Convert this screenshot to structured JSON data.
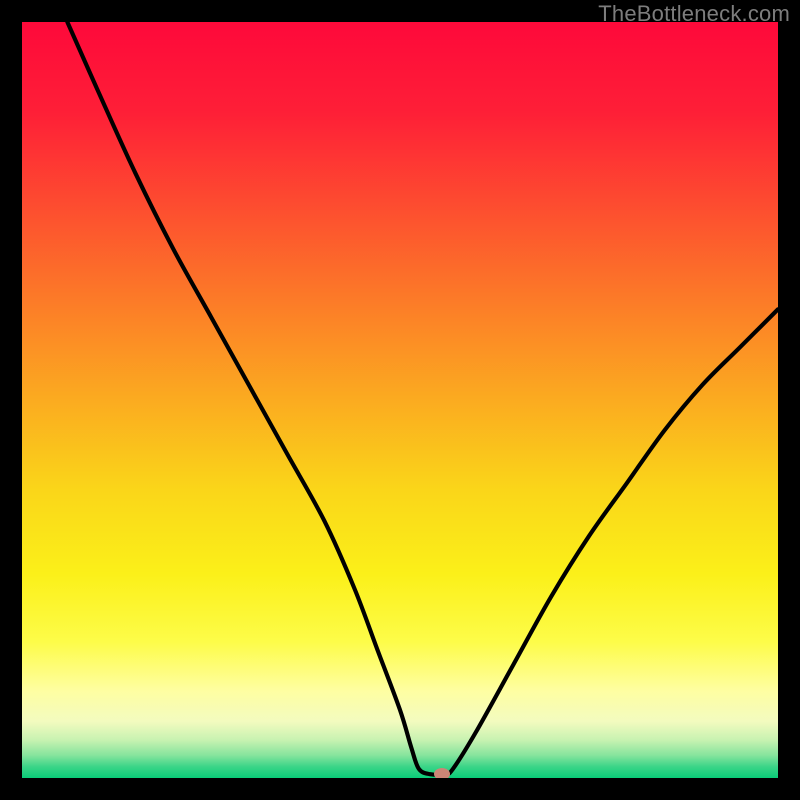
{
  "watermark": "TheBottleneck.com",
  "chart_data": {
    "type": "line",
    "title": "",
    "xlabel": "",
    "ylabel": "",
    "xlim": [
      0,
      100
    ],
    "ylim": [
      0,
      100
    ],
    "grid": false,
    "legend": false,
    "series": [
      {
        "name": "bottleneck-curve",
        "color": "#000000",
        "x": [
          6,
          10,
          15,
          20,
          25,
          30,
          35,
          40,
          44,
          47,
          50,
          51.5,
          52.5,
          54,
          56,
          57,
          60,
          65,
          70,
          75,
          80,
          85,
          90,
          95,
          100
        ],
        "y": [
          100,
          91,
          80,
          70,
          61,
          52,
          43,
          34,
          25,
          17,
          9,
          4,
          1.2,
          0.5,
          0.5,
          1.2,
          6,
          15,
          24,
          32,
          39,
          46,
          52,
          57,
          62
        ]
      }
    ],
    "marker": {
      "x": 55.5,
      "y": 0.5,
      "color": "#CB8576"
    },
    "background_gradient": {
      "stops": [
        {
          "offset": 0.0,
          "color": "#FE093A"
        },
        {
          "offset": 0.12,
          "color": "#FE1F37"
        },
        {
          "offset": 0.25,
          "color": "#FD4F2F"
        },
        {
          "offset": 0.38,
          "color": "#FC7F27"
        },
        {
          "offset": 0.5,
          "color": "#FBAB20"
        },
        {
          "offset": 0.62,
          "color": "#FAD619"
        },
        {
          "offset": 0.73,
          "color": "#FBF019"
        },
        {
          "offset": 0.82,
          "color": "#FDFC49"
        },
        {
          "offset": 0.885,
          "color": "#FEFEA2"
        },
        {
          "offset": 0.925,
          "color": "#F3FBBF"
        },
        {
          "offset": 0.95,
          "color": "#C7F2B1"
        },
        {
          "offset": 0.97,
          "color": "#86E49D"
        },
        {
          "offset": 0.985,
          "color": "#3BD588"
        },
        {
          "offset": 1.0,
          "color": "#0ACC78"
        }
      ]
    }
  }
}
